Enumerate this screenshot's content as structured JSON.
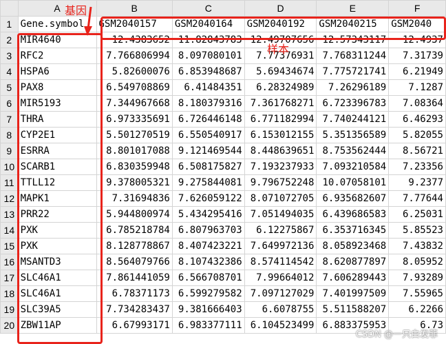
{
  "columns": [
    "A",
    "B",
    "C",
    "D",
    "E",
    "F"
  ],
  "header_row": {
    "row_num": "1",
    "cells": [
      "Gene.symbol",
      "GSM2040157",
      "GSM2040164",
      "GSM2040192",
      "GSM2040215",
      "GSM2040"
    ]
  },
  "rows": [
    {
      "n": "2",
      "gene": "MIR4640",
      "vals": [
        "12.4383652",
        "11.82843783",
        "12.49707656",
        "12.57343117",
        "12.4937"
      ]
    },
    {
      "n": "3",
      "gene": "RFC2",
      "vals": [
        "7.766806994",
        "8.097080101",
        "7.77376931",
        "7.768311244",
        "7.31739"
      ]
    },
    {
      "n": "4",
      "gene": "HSPA6",
      "vals": [
        "5.82600076",
        "6.853948687",
        "5.69434674",
        "7.775721741",
        "6.21949"
      ]
    },
    {
      "n": "5",
      "gene": "PAX8",
      "vals": [
        "6.549708869",
        "6.41484351",
        "6.28324989",
        "7.26296189",
        "7.1287"
      ]
    },
    {
      "n": "6",
      "gene": "MIR5193",
      "vals": [
        "7.344967668",
        "8.180379316",
        "7.361768271",
        "6.723396783",
        "7.08364"
      ]
    },
    {
      "n": "7",
      "gene": "THRA",
      "vals": [
        "6.973335691",
        "6.726446148",
        "6.771182994",
        "7.740244121",
        "6.46293"
      ]
    },
    {
      "n": "8",
      "gene": "CYP2E1",
      "vals": [
        "5.501270519",
        "6.550540917",
        "6.153012155",
        "5.351356589",
        "5.82055"
      ]
    },
    {
      "n": "9",
      "gene": "ESRRA",
      "vals": [
        "8.801017088",
        "9.121469544",
        "8.448639651",
        "8.753562444",
        "8.56721"
      ]
    },
    {
      "n": "10",
      "gene": "SCARB1",
      "vals": [
        "6.830359948",
        "6.508175827",
        "7.193237933",
        "7.093210584",
        "7.23356"
      ]
    },
    {
      "n": "11",
      "gene": "TTLL12",
      "vals": [
        "9.378005321",
        "9.275844081",
        "9.796752248",
        "10.07058101",
        "9.2377"
      ]
    },
    {
      "n": "12",
      "gene": "MAPK1",
      "vals": [
        "7.31694836",
        "7.626059122",
        "8.071072705",
        "6.935682607",
        "7.77644"
      ]
    },
    {
      "n": "13",
      "gene": "PRR22",
      "vals": [
        "5.944800974",
        "5.434295416",
        "7.051494035",
        "6.439686583",
        "6.25031"
      ]
    },
    {
      "n": "14",
      "gene": "PXK",
      "vals": [
        "6.785218784",
        "6.807963703",
        "6.12275867",
        "6.353716345",
        "5.85523"
      ]
    },
    {
      "n": "15",
      "gene": "PXK",
      "vals": [
        "8.128778867",
        "8.407423221",
        "7.649972136",
        "8.058923468",
        "7.43832"
      ]
    },
    {
      "n": "16",
      "gene": "MSANTD3",
      "vals": [
        "8.564079766",
        "8.107432386",
        "8.574114542",
        "8.620877897",
        "8.05952"
      ]
    },
    {
      "n": "17",
      "gene": "SLC46A1",
      "vals": [
        "7.861441059",
        "6.566708701",
        "7.99664012",
        "7.606289443",
        "7.93289"
      ]
    },
    {
      "n": "18",
      "gene": "SLC46A1",
      "vals": [
        "6.78371173",
        "6.599279582",
        "7.097127029",
        "7.401997509",
        "7.55965"
      ]
    },
    {
      "n": "19",
      "gene": "SLC39A5",
      "vals": [
        "7.734283437",
        "9.381666403",
        "6.6078755",
        "5.511588207",
        "6.2266"
      ]
    },
    {
      "n": "20",
      "gene": "ZBW11AP",
      "vals": [
        "6.67993171",
        "6.983377111",
        "6.104523499",
        "6.883375953",
        "6.73"
      ]
    }
  ],
  "annotations": {
    "gene_label": "基因",
    "sample_label": "样本",
    "accent_color": "#e8231b"
  },
  "watermark": "CSDN @一只白发菲"
}
